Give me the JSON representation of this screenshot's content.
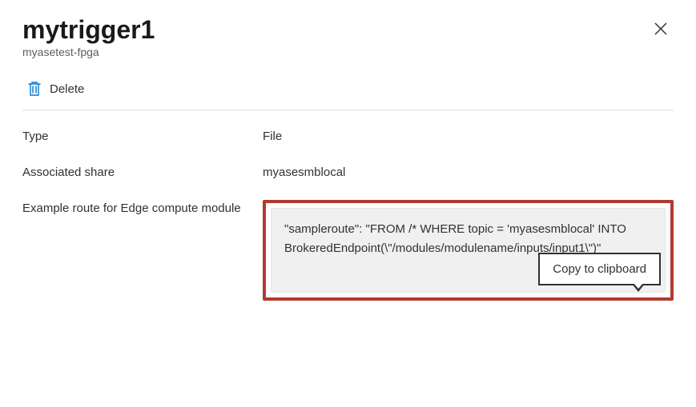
{
  "header": {
    "title": "mytrigger1",
    "subtitle": "myasetest-fpga"
  },
  "toolbar": {
    "delete_label": "Delete"
  },
  "details": {
    "type_label": "Type",
    "type_value": "File",
    "share_label": "Associated share",
    "share_value": "myasesmblocal",
    "route_label": "Example route for Edge compute module",
    "route_value": "\"sampleroute\": \"FROM /* WHERE topic = 'myasesmblocal' INTO BrokeredEndpoint(\\\"/modules/modulename/inputs/input1\\\")\""
  },
  "tooltip": {
    "copy": "Copy to clipboard"
  }
}
